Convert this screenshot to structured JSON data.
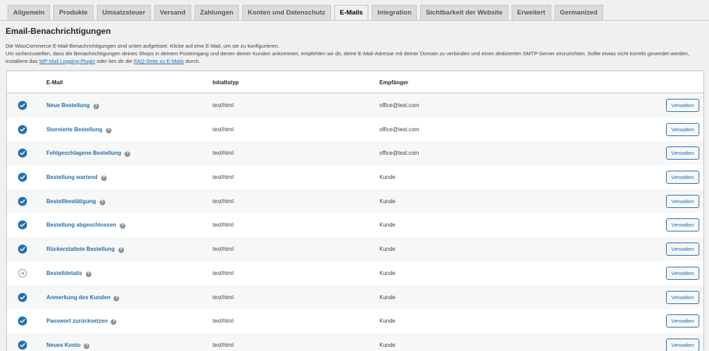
{
  "tabs": [
    {
      "label": "Allgemein",
      "active": false
    },
    {
      "label": "Produkte",
      "active": false
    },
    {
      "label": "Umsatzsteuer",
      "active": false
    },
    {
      "label": "Versand",
      "active": false
    },
    {
      "label": "Zahlungen",
      "active": false
    },
    {
      "label": "Konten und Datenschutz",
      "active": false
    },
    {
      "label": "E-Mails",
      "active": true
    },
    {
      "label": "Integration",
      "active": false
    },
    {
      "label": "Sichtbarkeit der Website",
      "active": false
    },
    {
      "label": "Erweitert",
      "active": false
    },
    {
      "label": "Germanized",
      "active": false
    }
  ],
  "page": {
    "title": "Email-Benachrichtigungen",
    "intro_line1": "Die WooCommerce E-Mail-Benachrichtigungen sind unten aufgelistet. Klicke auf eine E-Mail, um sie zu konfigurieren.",
    "intro_line2": "Um sicherzustellen, dass die Benachrichtigungen deines Shops in deinem Posteingang und denen deiner Kunden ankommen, empfehlen wir dir, deine E-Mail-Adresse mit deiner Domain zu verbinden und einen dedizierten SMTP-Server einzurichten. Sollte etwas nicht korrekt gesendet werden, installiere das",
    "intro_link1": "WP Mail Logging-Plugin",
    "intro_mid": "oder lies dir die",
    "intro_link2": "FAQ-Seite zu E-Mails",
    "intro_end": "durch."
  },
  "table": {
    "headers": {
      "email": "E-Mail",
      "content_type": "Inhaltstyp",
      "recipient": "Empfänger"
    },
    "help_glyph": "?",
    "manage_label": "Verwalten",
    "rows": [
      {
        "name": "Neue Bestellung",
        "content_type": "text/html",
        "recipient": "office@test.com",
        "status": "enabled"
      },
      {
        "name": "Stornierte Bestellung",
        "content_type": "text/html",
        "recipient": "office@test.com",
        "status": "enabled"
      },
      {
        "name": "Fehlgeschlagene Bestellung",
        "content_type": "text/html",
        "recipient": "office@test.com",
        "status": "enabled"
      },
      {
        "name": "Bestellung wartend",
        "content_type": "text/html",
        "recipient": "Kunde",
        "status": "enabled"
      },
      {
        "name": "Bestellbestätigung",
        "content_type": "text/html",
        "recipient": "Kunde",
        "status": "enabled"
      },
      {
        "name": "Bestellung abgeschlossen",
        "content_type": "text/html",
        "recipient": "Kunde",
        "status": "enabled"
      },
      {
        "name": "Rückerstattete Bestellung",
        "content_type": "text/html",
        "recipient": "Kunde",
        "status": "enabled"
      },
      {
        "name": "Bestelldetails",
        "content_type": "text/html",
        "recipient": "Kunde",
        "status": "manual"
      },
      {
        "name": "Anmerkung des Kunden",
        "content_type": "text/html",
        "recipient": "Kunde",
        "status": "enabled"
      },
      {
        "name": "Passwort zurücksetzen",
        "content_type": "text/html",
        "recipient": "Kunde",
        "status": "enabled"
      },
      {
        "name": "Neues Konto",
        "content_type": "text/html",
        "recipient": "Kunde",
        "status": "enabled"
      }
    ]
  },
  "icons": {
    "enabled": "check-circle-icon",
    "manual": "arrow-circle-icon"
  },
  "colors": {
    "accent": "#2271b1",
    "enabled_icon": "#2271b1",
    "manual_icon": "#8c8f94"
  }
}
